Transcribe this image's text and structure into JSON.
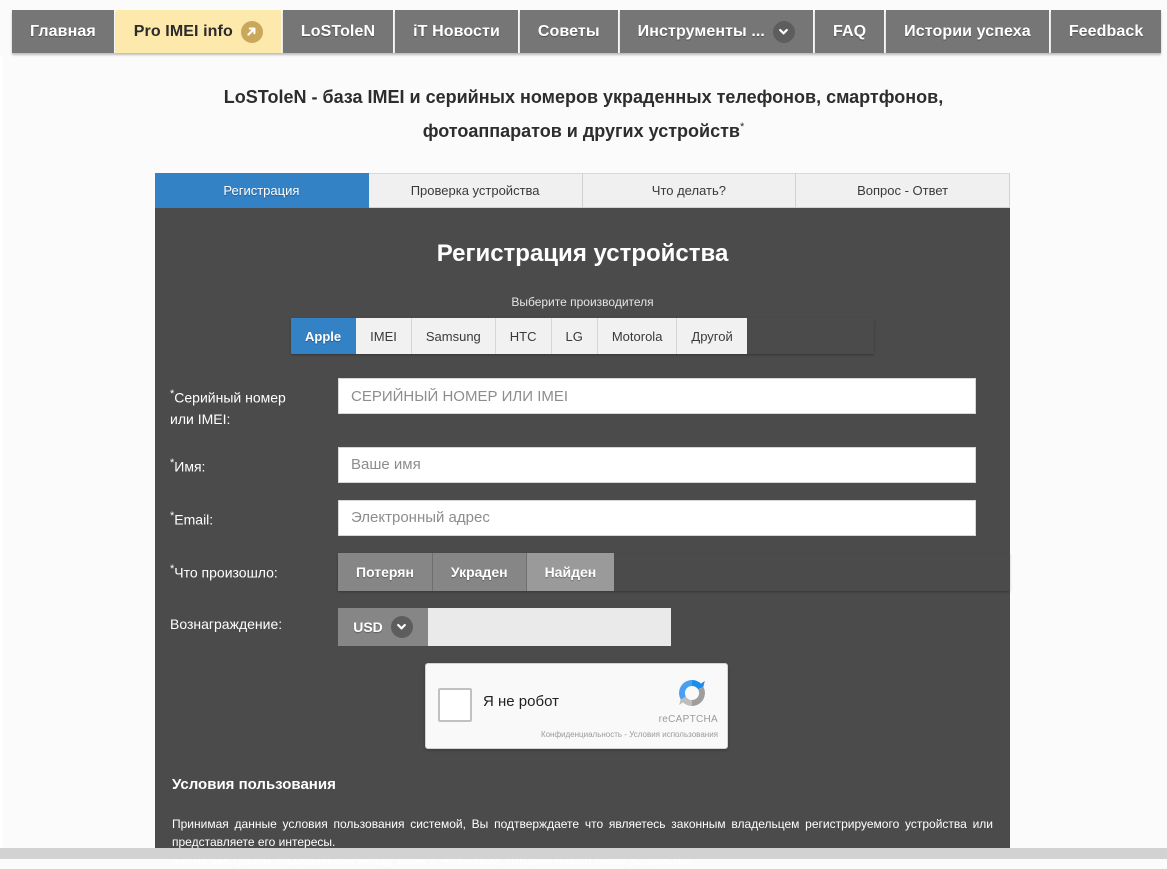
{
  "colors": {
    "nav_bg": "#767676",
    "nav_active_bg": "#fde9ab",
    "accent_blue": "#3382c6",
    "card_bg": "#4b4b4b",
    "page_bg": "#fbfbfb",
    "segment_bg": "#868686"
  },
  "topnav": {
    "items": [
      {
        "label": "Главная",
        "active": false,
        "icon": null
      },
      {
        "label": "Pro IMEI info",
        "active": true,
        "icon": "arrow-up-right-icon"
      },
      {
        "label": "LoSToleN",
        "active": false,
        "icon": null
      },
      {
        "label": "iT Новости",
        "active": false,
        "icon": null
      },
      {
        "label": "Советы",
        "active": false,
        "icon": null
      },
      {
        "label": "Инструменты ...",
        "active": false,
        "icon": "chevron-down-icon"
      },
      {
        "label": "FAQ",
        "active": false,
        "icon": null
      },
      {
        "label": "Истории успеха",
        "active": false,
        "icon": null
      },
      {
        "label": "Feedback",
        "active": false,
        "icon": null
      }
    ]
  },
  "heading": {
    "line1": "LoSToleN - база IMEI и серийных номеров украденных телефонов, смартфонов,",
    "line2": "фотоаппаратов и других устройств",
    "asterisk": "*"
  },
  "card": {
    "tabs": [
      {
        "label": "Регистрация",
        "active": true
      },
      {
        "label": "Проверка устройства",
        "active": false
      },
      {
        "label": "Что делать?",
        "active": false
      },
      {
        "label": "Вопрос - Ответ",
        "active": false
      }
    ],
    "form_title": "Регистрация устройства",
    "maker_label": "Выберите производителя",
    "makers": [
      {
        "label": "Apple",
        "active": true
      },
      {
        "label": "IMEI",
        "active": false
      },
      {
        "label": "Samsung",
        "active": false
      },
      {
        "label": "HTC",
        "active": false
      },
      {
        "label": "LG",
        "active": false
      },
      {
        "label": "Motorola",
        "active": false
      },
      {
        "label": "Другой",
        "active": false
      }
    ],
    "fields": {
      "serial": {
        "label_line1": "Серийный номер",
        "label_line2": "или IMEI:",
        "required": "*",
        "placeholder": "СЕРИЙНЫЙ НОМЕР ИЛИ IMEI",
        "value": ""
      },
      "name": {
        "label": "Имя:",
        "required": "*",
        "placeholder": "Ваше имя",
        "value": ""
      },
      "email": {
        "label": "Email:",
        "required": "*",
        "placeholder": "Электронный адрес",
        "value": ""
      },
      "status": {
        "label": "Что произошло:",
        "required": "*",
        "options": [
          {
            "label": "Потерян",
            "selected": false
          },
          {
            "label": "Украден",
            "selected": false
          },
          {
            "label": "Найден",
            "selected": true
          }
        ]
      },
      "reward": {
        "label": "Вознаграждение:",
        "currency": "USD",
        "currency_icon": "chevron-down-icon",
        "placeholder": "",
        "value": ""
      }
    },
    "recaptcha": {
      "checkbox_label": "Я не робот",
      "brand": "reCAPTCHA",
      "links": "Конфиденциальность - Условия использования",
      "logo_icon": "recaptcha-logo-icon"
    },
    "terms": {
      "title": "Условия пользования",
      "paragraph1": "Принимая данные условия пользования системой, Вы подтверждаете что являетесь законным владельцем регистрируемого устройства или представляете его интересы.",
      "paragraph2": "Мы не выступаем посредниками между Вами и человеком, который нашел Ваше устройство."
    }
  }
}
